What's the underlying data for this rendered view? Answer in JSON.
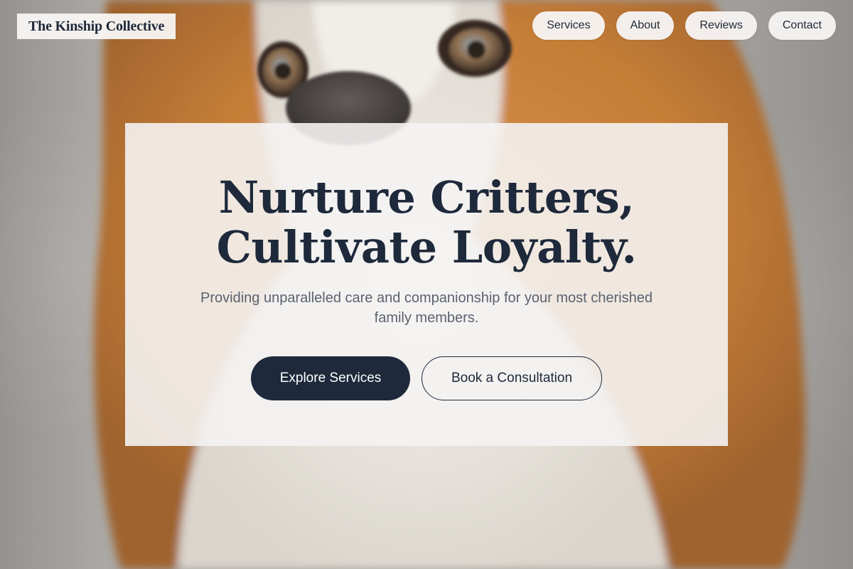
{
  "brand": {
    "name": "The Kinship Collective"
  },
  "nav": {
    "items": [
      {
        "label": "Services"
      },
      {
        "label": "About"
      },
      {
        "label": "Reviews"
      },
      {
        "label": "Contact"
      }
    ]
  },
  "hero": {
    "title_line_1": "Nurture Critters,",
    "title_line_2": "Cultivate Loyalty.",
    "subtitle": "Providing unparalleled care and companionship for your most cherished family members.",
    "primary_cta": "Explore Services",
    "secondary_cta": "Book a Consultation",
    "background_image": "corgi-photo"
  },
  "colors": {
    "primary": "#1e293b",
    "subtitle_text": "#5b6270",
    "card_background": "#f4f3f2"
  }
}
